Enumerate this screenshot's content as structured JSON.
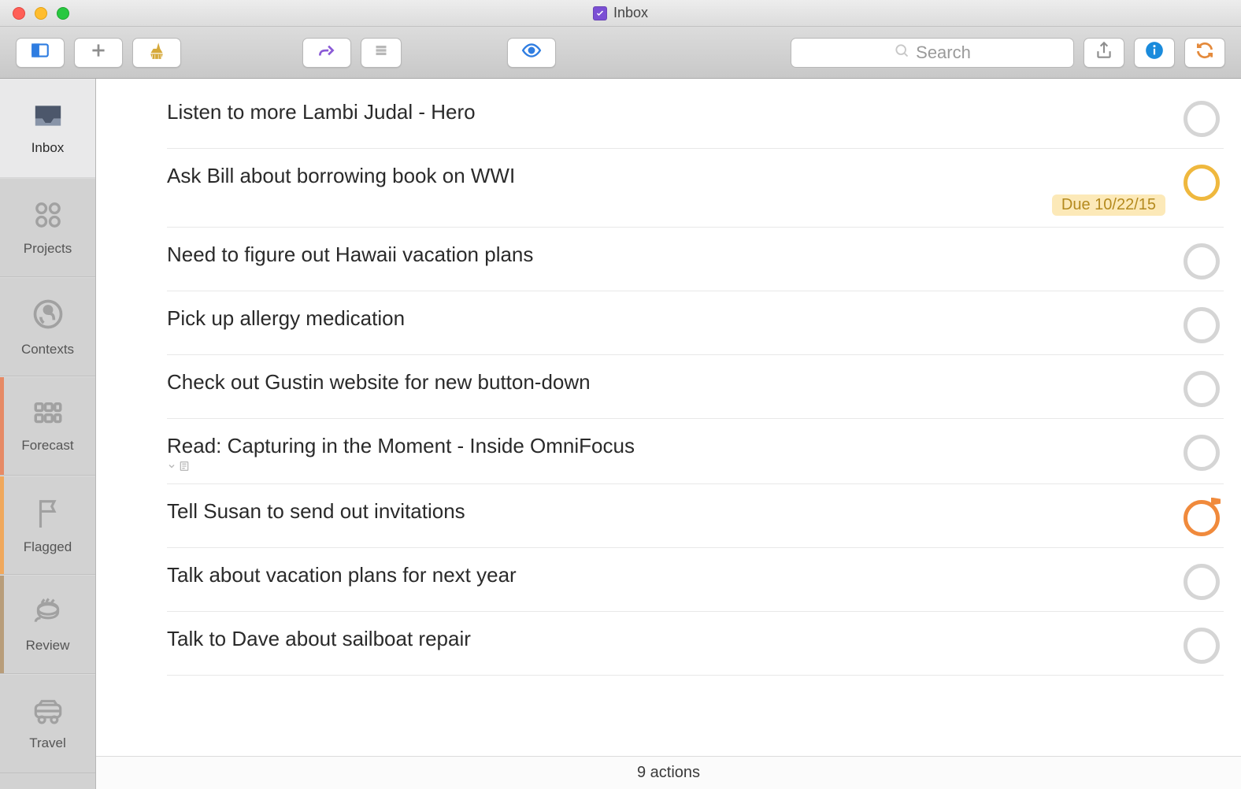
{
  "window": {
    "title": "Inbox"
  },
  "toolbar": {
    "search_placeholder": "Search"
  },
  "sidebar": {
    "items": [
      {
        "id": "inbox",
        "label": "Inbox",
        "selected": true
      },
      {
        "id": "projects",
        "label": "Projects",
        "selected": false
      },
      {
        "id": "contexts",
        "label": "Contexts",
        "selected": false
      },
      {
        "id": "forecast",
        "label": "Forecast",
        "selected": false,
        "tint": "forecast"
      },
      {
        "id": "flagged",
        "label": "Flagged",
        "selected": false,
        "tint": "flagged"
      },
      {
        "id": "review",
        "label": "Review",
        "selected": false,
        "tint": "review"
      },
      {
        "id": "travel",
        "label": "Travel",
        "selected": false
      }
    ]
  },
  "tasks": [
    {
      "title": "Listen to more Lambi Judal - Hero",
      "status": "normal"
    },
    {
      "title": "Ask Bill about borrowing book on WWI",
      "status": "due-soon",
      "due": "Due 10/22/15"
    },
    {
      "title": "Need to figure out Hawaii vacation plans",
      "status": "normal"
    },
    {
      "title": "Pick up allergy medication",
      "status": "normal"
    },
    {
      "title": "Check out Gustin website for new button-down",
      "status": "normal"
    },
    {
      "title": "Read: Capturing in the Moment - Inside OmniFocus",
      "status": "normal",
      "has_note": true
    },
    {
      "title": "Tell Susan to send out invitations",
      "status": "flagged"
    },
    {
      "title": "Talk about vacation plans for next year",
      "status": "normal"
    },
    {
      "title": "Talk to Dave about sailboat repair",
      "status": "normal"
    }
  ],
  "statusbar": {
    "summary": "9 actions"
  }
}
